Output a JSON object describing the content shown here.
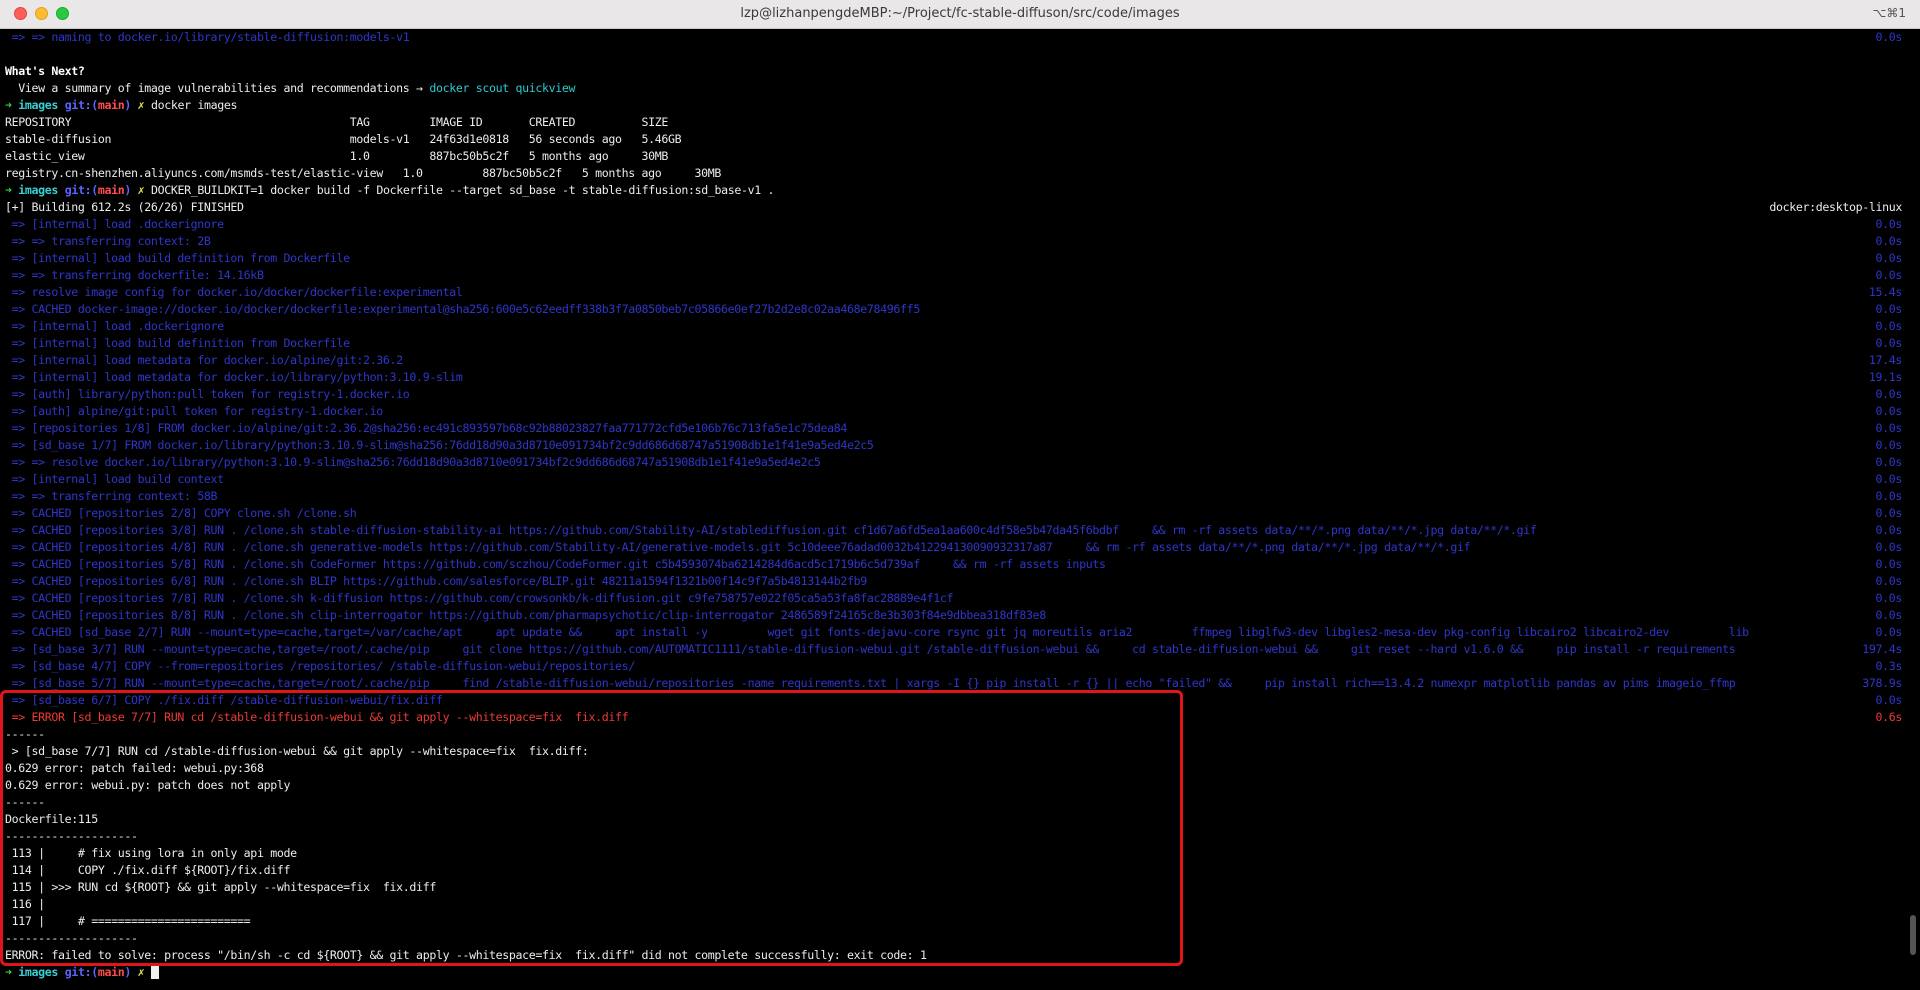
{
  "window": {
    "title": "lzp@lizhanpengdeMBP:~/Project/fc-stable-diffuson/src/code/images",
    "shortcut": "⌥⌘1"
  },
  "terminal": {
    "top_line": {
      "text": " => => naming to docker.io/library/stable-diffusion:models-v1",
      "time": "0.0s"
    },
    "whats_next": "What's Next?",
    "summary_prefix": "  View a summary of image vulnerabilities and recommendations → ",
    "summary_cmd": "docker scout quickview",
    "prompt1": {
      "arrow": "➜",
      "dir": "images",
      "git": "git:(",
      "branch": "main",
      "git_close": ")",
      "x": "✗",
      "cmd": "docker images"
    },
    "images_header": "REPOSITORY                                          TAG         IMAGE ID       CREATED          SIZE",
    "images_rows": [
      "stable-diffusion                                    models-v1   24f63d1e0818   56 seconds ago   5.46GB",
      "elastic_view                                        1.0         887bc50b5c2f   5 months ago     30MB",
      "registry.cn-shenzhen.aliyuncs.com/msmds-test/elastic-view   1.0         887bc50b5c2f   5 months ago     30MB"
    ],
    "prompt2": {
      "arrow": "➜",
      "dir": "images",
      "git": "git:(",
      "branch": "main",
      "git_close": ")",
      "x": "✗",
      "cmd": "DOCKER_BUILDKIT=1 docker build -f Dockerfile --target sd_base -t stable-diffusion:sd_base-v1 ."
    },
    "building": {
      "text": "[+] Building 612.2s (26/26) FINISHED",
      "context": "docker:desktop-linux"
    },
    "build_steps": [
      {
        "text": " => [internal] load .dockerignore",
        "time": "0.0s"
      },
      {
        "text": " => => transferring context: 2B",
        "time": "0.0s"
      },
      {
        "text": " => [internal] load build definition from Dockerfile",
        "time": "0.0s"
      },
      {
        "text": " => => transferring dockerfile: 14.16kB",
        "time": "0.0s"
      },
      {
        "text": " => resolve image config for docker.io/docker/dockerfile:experimental",
        "time": "15.4s"
      },
      {
        "text": " => CACHED docker-image://docker.io/docker/dockerfile:experimental@sha256:600e5c62eedff338b3f7a0850beb7c05866e0ef27b2d2e8c02aa468e78496ff5",
        "time": "0.0s"
      },
      {
        "text": " => [internal] load .dockerignore",
        "time": "0.0s"
      },
      {
        "text": " => [internal] load build definition from Dockerfile",
        "time": "0.0s"
      },
      {
        "text": " => [internal] load metadata for docker.io/alpine/git:2.36.2",
        "time": "17.4s"
      },
      {
        "text": " => [internal] load metadata for docker.io/library/python:3.10.9-slim",
        "time": "19.1s"
      },
      {
        "text": " => [auth] library/python:pull token for registry-1.docker.io",
        "time": "0.0s"
      },
      {
        "text": " => [auth] alpine/git:pull token for registry-1.docker.io",
        "time": "0.0s"
      },
      {
        "text": " => [repositories 1/8] FROM docker.io/alpine/git:2.36.2@sha256:ec491c893597b68c92b88023827faa771772cfd5e106b76c713fa5e1c75dea84",
        "time": "0.0s"
      },
      {
        "text": " => [sd_base 1/7] FROM docker.io/library/python:3.10.9-slim@sha256:76dd18d90a3d8710e091734bf2c9dd686d68747a51908db1e1f41e9a5ed4e2c5",
        "time": "0.0s"
      },
      {
        "text": " => => resolve docker.io/library/python:3.10.9-slim@sha256:76dd18d90a3d8710e091734bf2c9dd686d68747a51908db1e1f41e9a5ed4e2c5",
        "time": "0.0s"
      },
      {
        "text": " => [internal] load build context",
        "time": "0.0s"
      },
      {
        "text": " => => transferring context: 58B",
        "time": "0.0s"
      },
      {
        "text": " => CACHED [repositories 2/8] COPY clone.sh /clone.sh",
        "time": "0.0s"
      },
      {
        "text": " => CACHED [repositories 3/8] RUN . /clone.sh stable-diffusion-stability-ai https://github.com/Stability-AI/stablediffusion.git cf1d67a6fd5ea1aa600c4df58e5b47da45f6bdbf     && rm -rf assets data/**/*.png data/**/*.jpg data/**/*.gif",
        "time": "0.0s"
      },
      {
        "text": " => CACHED [repositories 4/8] RUN . /clone.sh generative-models https://github.com/Stability-AI/generative-models.git 5c10deee76adad0032b412294130090932317a87     && rm -rf assets data/**/*.png data/**/*.jpg data/**/*.gif",
        "time": "0.0s"
      },
      {
        "text": " => CACHED [repositories 5/8] RUN . /clone.sh CodeFormer https://github.com/sczhou/CodeFormer.git c5b4593074ba6214284d6acd5c1719b6c5d739af     && rm -rf assets inputs",
        "time": "0.0s"
      },
      {
        "text": " => CACHED [repositories 6/8] RUN . /clone.sh BLIP https://github.com/salesforce/BLIP.git 48211a1594f1321b00f14c9f7a5b4813144b2fb9",
        "time": "0.0s"
      },
      {
        "text": " => CACHED [repositories 7/8] RUN . /clone.sh k-diffusion https://github.com/crowsonkb/k-diffusion.git c9fe758757e022f05ca5a53fa8fac28889e4f1cf",
        "time": "0.0s"
      },
      {
        "text": " => CACHED [repositories 8/8] RUN . /clone.sh clip-interrogator https://github.com/pharmapsychotic/clip-interrogator 2486589f24165c8e3b303f84e9dbbea318df83e8",
        "time": "0.0s"
      },
      {
        "text": " => CACHED [sd_base 2/7] RUN --mount=type=cache,target=/var/cache/apt     apt update &&     apt install -y         wget git fonts-dejavu-core rsync git jq moreutils aria2         ffmpeg libglfw3-dev libgles2-mesa-dev pkg-config libcairo2 libcairo2-dev         lib",
        "time": "0.0s"
      },
      {
        "text": " => [sd_base 3/7] RUN --mount=type=cache,target=/root/.cache/pip     git clone https://github.com/AUTOMATIC1111/stable-diffusion-webui.git /stable-diffusion-webui &&     cd stable-diffusion-webui &&     git reset --hard v1.6.0 &&     pip install -r requirements",
        "time": "197.4s"
      },
      {
        "text": " => [sd_base 4/7] COPY --from=repositories /repositories/ /stable-diffusion-webui/repositories/",
        "time": "0.3s"
      },
      {
        "text": " => [sd_base 5/7] RUN --mount=type=cache,target=/root/.cache/pip     find /stable-diffusion-webui/repositories -name requirements.txt | xargs -I {} pip install -r {} || echo \"failed\" &&     pip install rich==13.4.2 numexpr matplotlib pandas av pims imageio_ffmp",
        "time": "378.9s"
      }
    ],
    "copy_step": {
      "text": " => [sd_base 6/7] COPY ./fix.diff /stable-diffusion-webui/fix.diff",
      "time": "0.0s"
    },
    "error_step": {
      "text": " => ERROR [sd_base 7/7] RUN cd /stable-diffusion-webui && git apply --whitespace=fix  fix.diff",
      "time": "0.6s"
    },
    "error_block": [
      "------",
      " > [sd_base 7/7] RUN cd /stable-diffusion-webui && git apply --whitespace=fix  fix.diff:",
      "0.629 error: patch failed: webui.py:368",
      "0.629 error: webui.py: patch does not apply",
      "------",
      "Dockerfile:115",
      "--------------------",
      " 113 |     # fix using lora in only api mode",
      " 114 |     COPY ./fix.diff ${ROOT}/fix.diff",
      " 115 | >>> RUN cd ${ROOT} && git apply --whitespace=fix  fix.diff",
      " 116 |",
      " 117 |     # ========================",
      "--------------------",
      "ERROR: failed to solve: process \"/bin/sh -c cd ${ROOT} && git apply --whitespace=fix  fix.diff\" did not complete successfully: exit code: 1"
    ],
    "prompt3": {
      "arrow": "➜",
      "dir": "images",
      "git": "git:(",
      "branch": "main",
      "git_close": ")",
      "x": "✗"
    }
  },
  "colors": {
    "background": "#000000",
    "build_step": "#2f36c9",
    "error": "#ee3a33",
    "highlight_border": "#e0151b",
    "prompt_arrow": "#3ad13f",
    "prompt_dir": "#3ad0d6"
  }
}
